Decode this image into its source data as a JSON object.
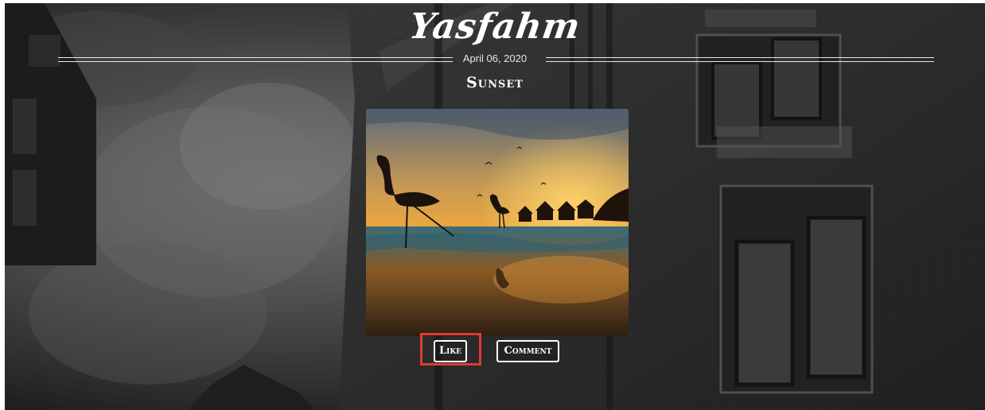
{
  "site": {
    "logo_text": "Yasfahm"
  },
  "post": {
    "date": "April 06, 2020",
    "title": "Sunset",
    "photo_subject": "flamingo silhouettes on a beach at sunset"
  },
  "actions": {
    "like_label": "Like",
    "comment_label": "Comment"
  },
  "colors": {
    "text": "#ffffff",
    "highlight": "#e53935",
    "background": "#2f2f2f"
  }
}
